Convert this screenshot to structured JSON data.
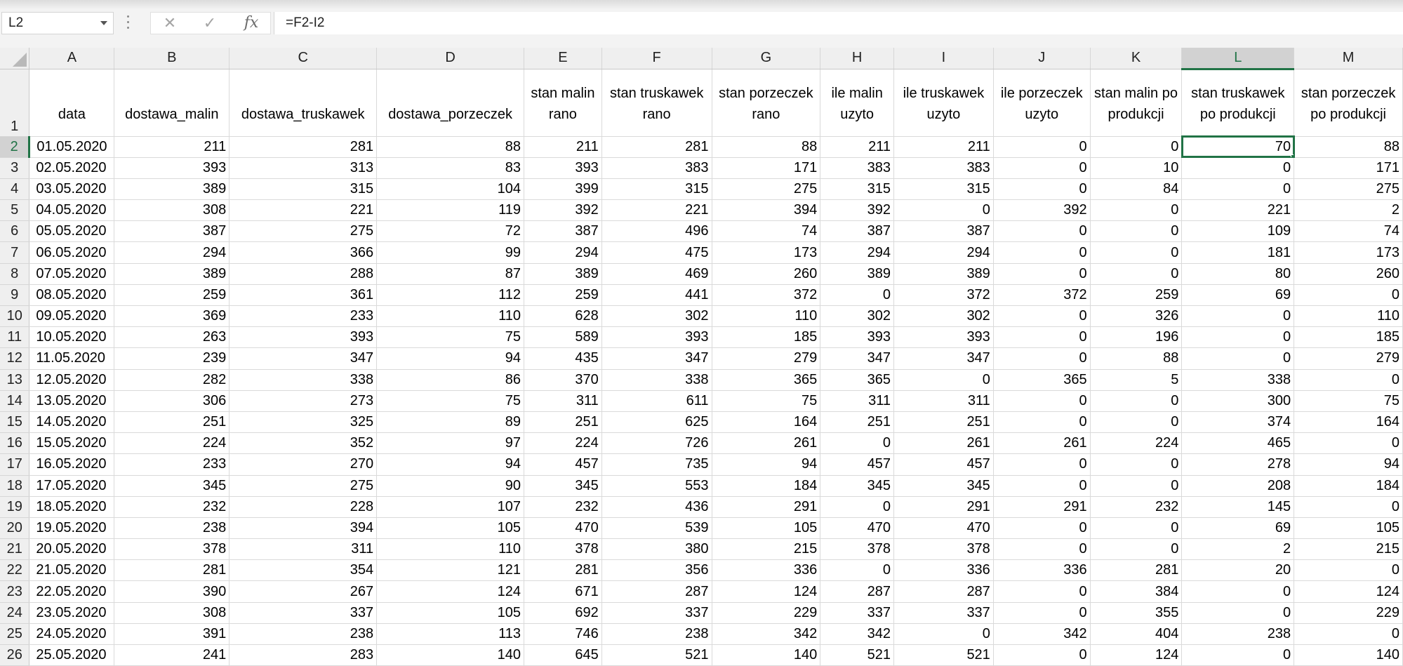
{
  "formula_bar": {
    "name_box": "L2",
    "cancel_icon": "✕",
    "enter_icon": "✓",
    "fx_label": "fx",
    "formula": "=F2-I2"
  },
  "columns": [
    "A",
    "B",
    "C",
    "D",
    "E",
    "F",
    "G",
    "H",
    "I",
    "J",
    "K",
    "L",
    "M"
  ],
  "active_column": "L",
  "headers": [
    "data",
    "dostawa_malin",
    "dostawa_truskawek",
    "dostawa_porzeczek",
    "stan malin rano",
    "stan truskawek rano",
    "stan porzeczek rano",
    "ile malin uzyto",
    "ile truskawek uzyto",
    "ile porzeczek uzyto",
    "stan malin po produkcji",
    "stan truskawek po produkcji",
    "stan porzeczek po produkcji"
  ],
  "rows": [
    {
      "n": "2",
      "c": [
        "01.05.2020",
        "211",
        "281",
        "88",
        "211",
        "281",
        "88",
        "211",
        "211",
        "0",
        "0",
        "70",
        "88"
      ]
    },
    {
      "n": "3",
      "c": [
        "02.05.2020",
        "393",
        "313",
        "83",
        "393",
        "383",
        "171",
        "383",
        "383",
        "0",
        "10",
        "0",
        "171"
      ]
    },
    {
      "n": "4",
      "c": [
        "03.05.2020",
        "389",
        "315",
        "104",
        "399",
        "315",
        "275",
        "315",
        "315",
        "0",
        "84",
        "0",
        "275"
      ]
    },
    {
      "n": "5",
      "c": [
        "04.05.2020",
        "308",
        "221",
        "119",
        "392",
        "221",
        "394",
        "392",
        "0",
        "392",
        "0",
        "221",
        "2"
      ]
    },
    {
      "n": "6",
      "c": [
        "05.05.2020",
        "387",
        "275",
        "72",
        "387",
        "496",
        "74",
        "387",
        "387",
        "0",
        "0",
        "109",
        "74"
      ]
    },
    {
      "n": "7",
      "c": [
        "06.05.2020",
        "294",
        "366",
        "99",
        "294",
        "475",
        "173",
        "294",
        "294",
        "0",
        "0",
        "181",
        "173"
      ]
    },
    {
      "n": "8",
      "c": [
        "07.05.2020",
        "389",
        "288",
        "87",
        "389",
        "469",
        "260",
        "389",
        "389",
        "0",
        "0",
        "80",
        "260"
      ]
    },
    {
      "n": "9",
      "c": [
        "08.05.2020",
        "259",
        "361",
        "112",
        "259",
        "441",
        "372",
        "0",
        "372",
        "372",
        "259",
        "69",
        "0"
      ]
    },
    {
      "n": "10",
      "c": [
        "09.05.2020",
        "369",
        "233",
        "110",
        "628",
        "302",
        "110",
        "302",
        "302",
        "0",
        "326",
        "0",
        "110"
      ]
    },
    {
      "n": "11",
      "c": [
        "10.05.2020",
        "263",
        "393",
        "75",
        "589",
        "393",
        "185",
        "393",
        "393",
        "0",
        "196",
        "0",
        "185"
      ]
    },
    {
      "n": "12",
      "c": [
        "11.05.2020",
        "239",
        "347",
        "94",
        "435",
        "347",
        "279",
        "347",
        "347",
        "0",
        "88",
        "0",
        "279"
      ]
    },
    {
      "n": "13",
      "c": [
        "12.05.2020",
        "282",
        "338",
        "86",
        "370",
        "338",
        "365",
        "365",
        "0",
        "365",
        "5",
        "338",
        "0"
      ]
    },
    {
      "n": "14",
      "c": [
        "13.05.2020",
        "306",
        "273",
        "75",
        "311",
        "611",
        "75",
        "311",
        "311",
        "0",
        "0",
        "300",
        "75"
      ]
    },
    {
      "n": "15",
      "c": [
        "14.05.2020",
        "251",
        "325",
        "89",
        "251",
        "625",
        "164",
        "251",
        "251",
        "0",
        "0",
        "374",
        "164"
      ]
    },
    {
      "n": "16",
      "c": [
        "15.05.2020",
        "224",
        "352",
        "97",
        "224",
        "726",
        "261",
        "0",
        "261",
        "261",
        "224",
        "465",
        "0"
      ]
    },
    {
      "n": "17",
      "c": [
        "16.05.2020",
        "233",
        "270",
        "94",
        "457",
        "735",
        "94",
        "457",
        "457",
        "0",
        "0",
        "278",
        "94"
      ]
    },
    {
      "n": "18",
      "c": [
        "17.05.2020",
        "345",
        "275",
        "90",
        "345",
        "553",
        "184",
        "345",
        "345",
        "0",
        "0",
        "208",
        "184"
      ]
    },
    {
      "n": "19",
      "c": [
        "18.05.2020",
        "232",
        "228",
        "107",
        "232",
        "436",
        "291",
        "0",
        "291",
        "291",
        "232",
        "145",
        "0"
      ]
    },
    {
      "n": "20",
      "c": [
        "19.05.2020",
        "238",
        "394",
        "105",
        "470",
        "539",
        "105",
        "470",
        "470",
        "0",
        "0",
        "69",
        "105"
      ]
    },
    {
      "n": "21",
      "c": [
        "20.05.2020",
        "378",
        "311",
        "110",
        "378",
        "380",
        "215",
        "378",
        "378",
        "0",
        "0",
        "2",
        "215"
      ]
    },
    {
      "n": "22",
      "c": [
        "21.05.2020",
        "281",
        "354",
        "121",
        "281",
        "356",
        "336",
        "0",
        "336",
        "336",
        "281",
        "20",
        "0"
      ]
    },
    {
      "n": "23",
      "c": [
        "22.05.2020",
        "390",
        "267",
        "124",
        "671",
        "287",
        "124",
        "287",
        "287",
        "0",
        "384",
        "0",
        "124"
      ]
    },
    {
      "n": "24",
      "c": [
        "23.05.2020",
        "308",
        "337",
        "105",
        "692",
        "337",
        "229",
        "337",
        "337",
        "0",
        "355",
        "0",
        "229"
      ]
    },
    {
      "n": "25",
      "c": [
        "24.05.2020",
        "391",
        "238",
        "113",
        "746",
        "238",
        "342",
        "342",
        "0",
        "342",
        "404",
        "238",
        "0"
      ]
    },
    {
      "n": "26",
      "c": [
        "25.05.2020",
        "241",
        "283",
        "140",
        "645",
        "521",
        "140",
        "521",
        "521",
        "0",
        "124",
        "0",
        "140"
      ]
    }
  ]
}
